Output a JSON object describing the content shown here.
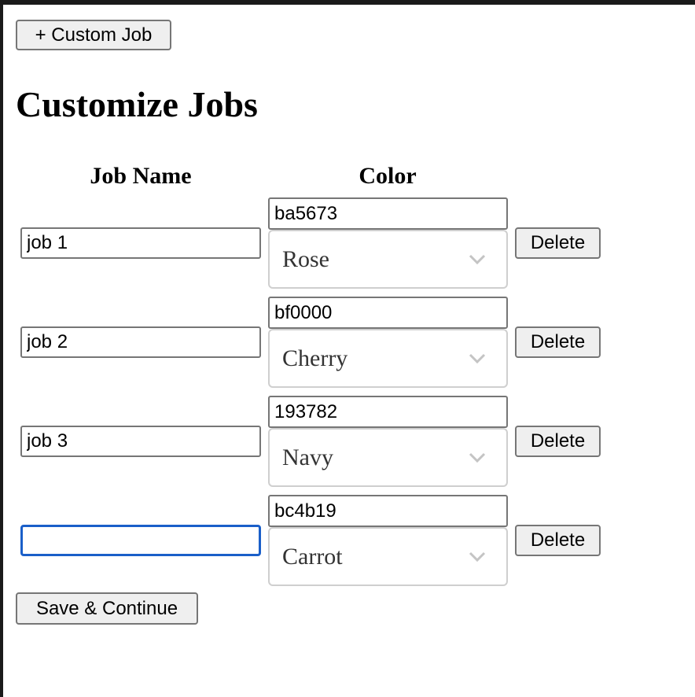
{
  "toolbar": {
    "custom_job_label": "+ Custom Job"
  },
  "page": {
    "title": "Customize Jobs"
  },
  "table": {
    "headers": {
      "name": "Job Name",
      "color": "Color"
    },
    "rows": [
      {
        "name": "job 1",
        "name_placeholder": "",
        "hex": "ba5673",
        "color_name": "Rose",
        "delete_label": "Delete"
      },
      {
        "name": "job 2",
        "name_placeholder": "",
        "hex": "bf0000",
        "color_name": "Cherry",
        "delete_label": "Delete"
      },
      {
        "name": "job 3",
        "name_placeholder": "",
        "hex": "193782",
        "color_name": "Navy",
        "delete_label": "Delete"
      },
      {
        "name": "",
        "name_placeholder": "",
        "hex": "bc4b19",
        "color_name": "Carrot",
        "delete_label": "Delete"
      }
    ]
  },
  "footer": {
    "save_label": "Save & Continue"
  },
  "icons": {
    "dropdown": "chevron-down-icon"
  },
  "colors": {
    "focus_ring": "#1a5fc9",
    "button_bg": "#efefef",
    "border": "#767676"
  }
}
